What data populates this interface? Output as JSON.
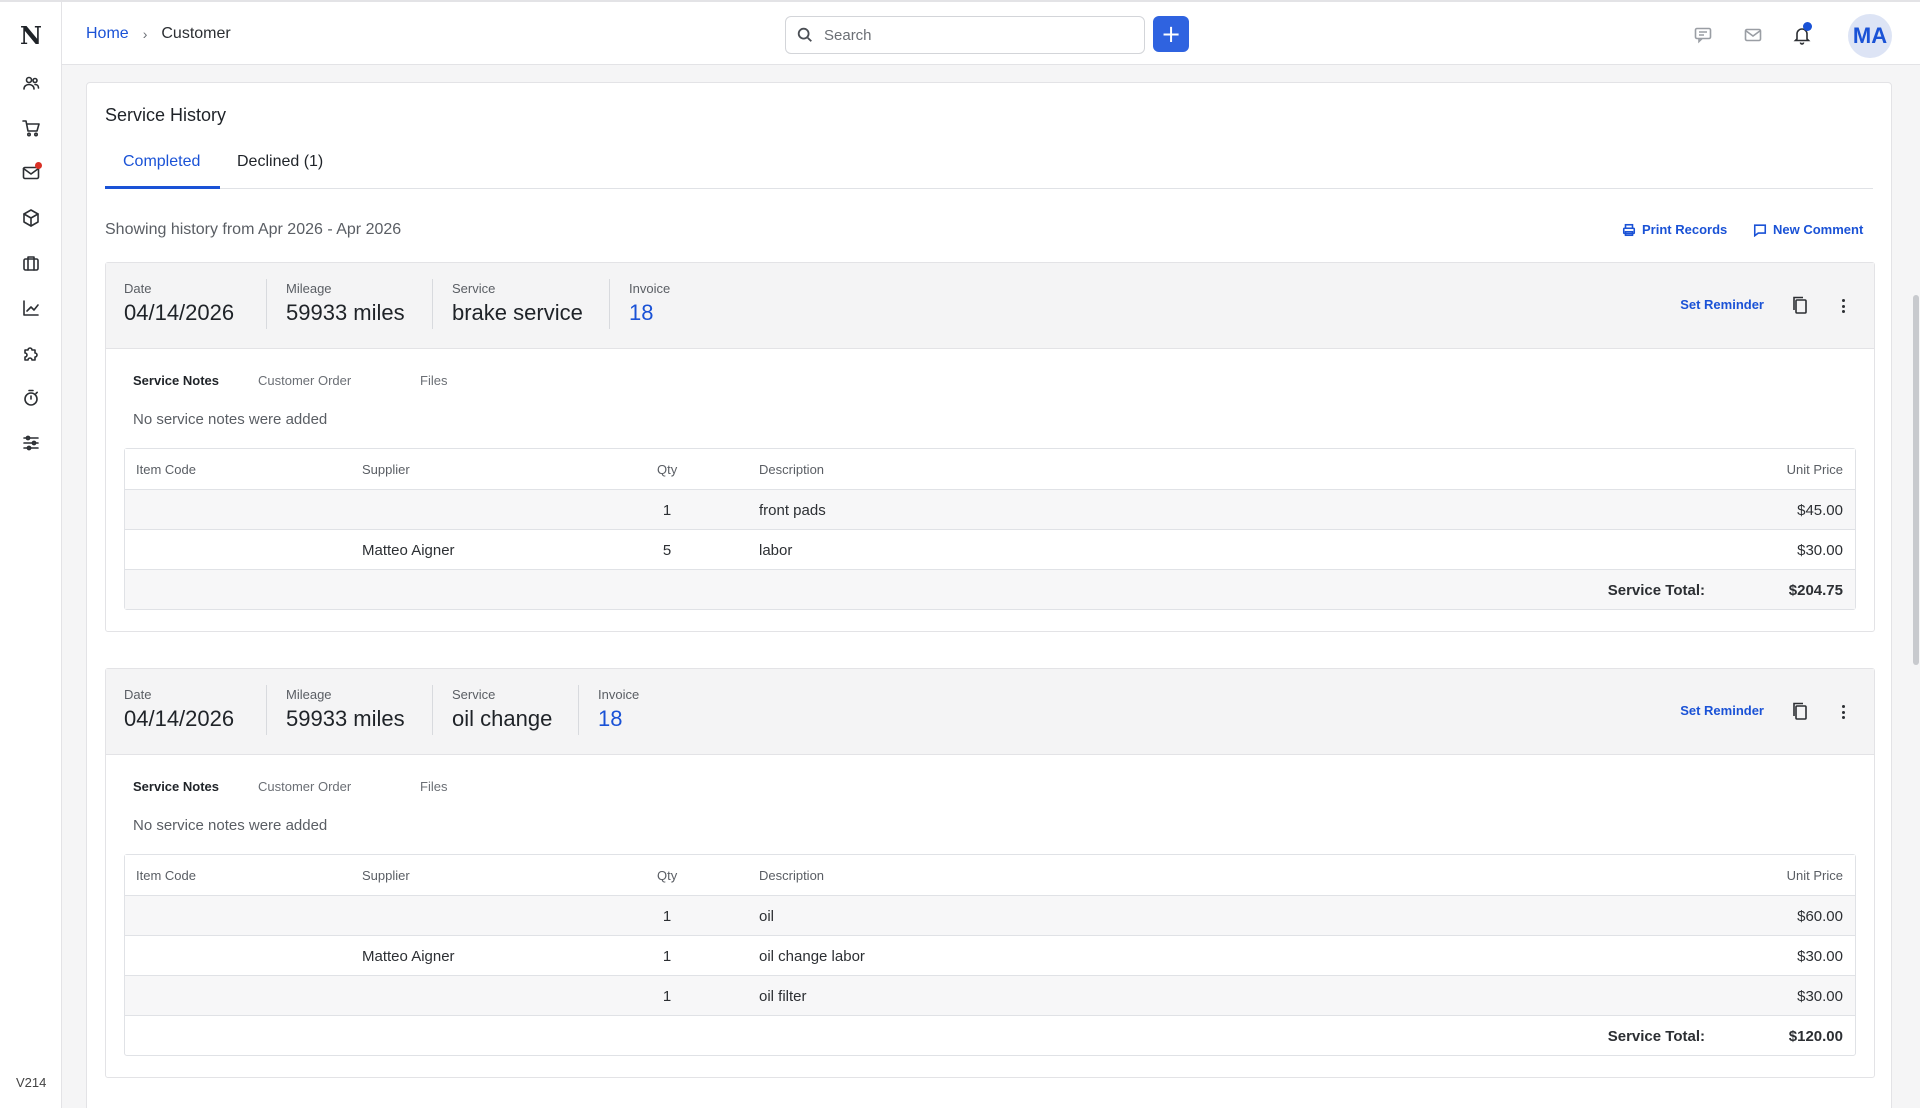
{
  "sidebar": {
    "logo": "N",
    "icons": [
      "customers-icon",
      "cart-icon",
      "mail-icon",
      "box-icon",
      "briefcase-icon",
      "chart-icon",
      "puzzle-icon",
      "timer-icon",
      "sliders-icon"
    ],
    "version": "V214"
  },
  "header": {
    "breadcrumb_home": "Home",
    "breadcrumb_sep": "›",
    "breadcrumb_current": "Customer",
    "search_placeholder": "Search",
    "add_label": "+",
    "avatar_initials": "MA"
  },
  "page": {
    "title": "Service History",
    "tabs": [
      {
        "label": "Completed",
        "active": true
      },
      {
        "label": "Declined (1)",
        "active": false
      }
    ],
    "history_range": "Showing history from Apr 2026 - Apr 2026",
    "print_label": "Print Records",
    "comment_label": "New Comment"
  },
  "labels": {
    "date": "Date",
    "mileage": "Mileage",
    "service": "Service",
    "invoice": "Invoice",
    "set_reminder": "Set Reminder",
    "service_notes": "Service Notes",
    "customer_order": "Customer Order",
    "files": "Files",
    "no_notes": "No service notes were added",
    "col_item_code": "Item Code",
    "col_supplier": "Supplier",
    "col_qty": "Qty",
    "col_description": "Description",
    "col_unit_price": "Unit Price",
    "service_total": "Service Total:"
  },
  "services": [
    {
      "date": "04/14/2026",
      "mileage": "59933 miles",
      "service": "brake service",
      "invoice": "18",
      "items": [
        {
          "code": "",
          "supplier": "",
          "qty": "1",
          "description": "front pads",
          "price": "$45.00"
        },
        {
          "code": "",
          "supplier": "Matteo Aigner",
          "qty": "5",
          "description": "labor",
          "price": "$30.00"
        }
      ],
      "total": "$204.75"
    },
    {
      "date": "04/14/2026",
      "mileage": "59933 miles",
      "service": "oil change",
      "invoice": "18",
      "items": [
        {
          "code": "",
          "supplier": "",
          "qty": "1",
          "description": "oil",
          "price": "$60.00"
        },
        {
          "code": "",
          "supplier": "Matteo Aigner",
          "qty": "1",
          "description": "oil change labor",
          "price": "$30.00"
        },
        {
          "code": "",
          "supplier": "",
          "qty": "1",
          "description": "oil filter",
          "price": "$30.00"
        }
      ],
      "total": "$120.00"
    }
  ]
}
